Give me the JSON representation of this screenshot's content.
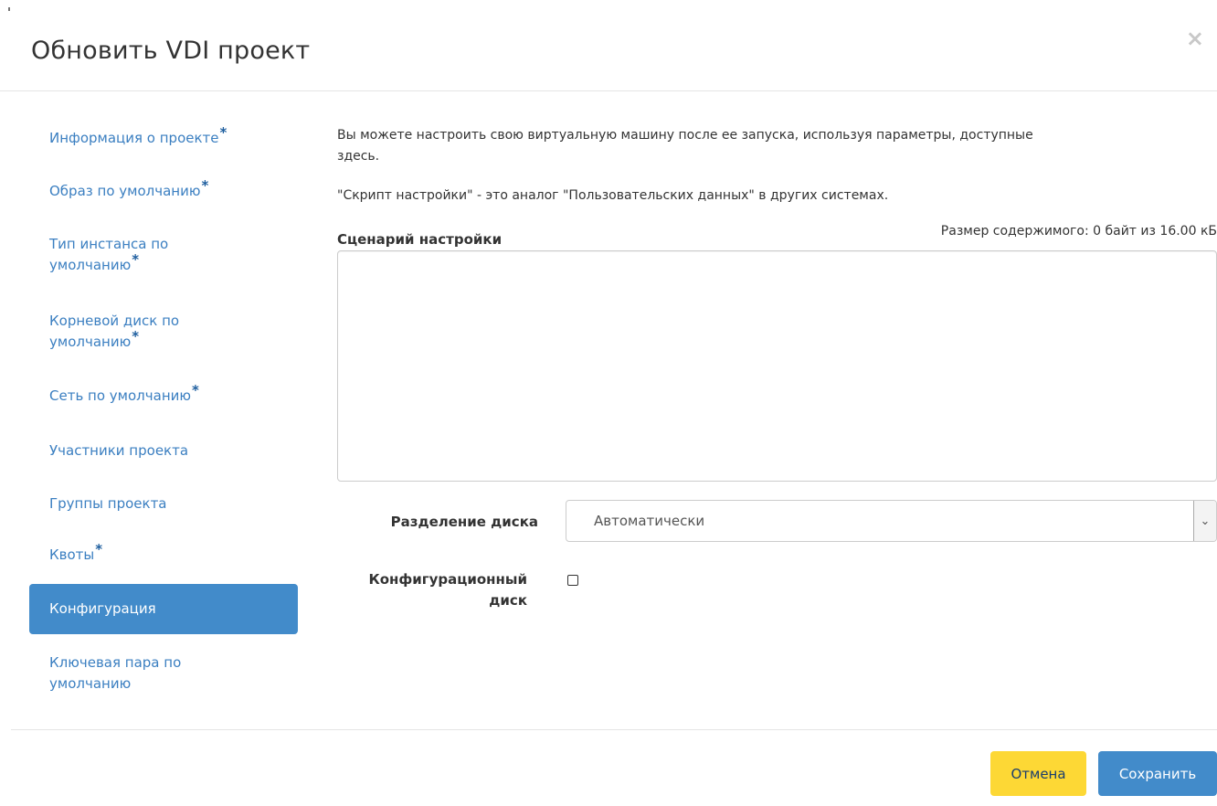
{
  "dialog": {
    "title": "Обновить VDI проект",
    "close_icon": "×"
  },
  "sidebar": {
    "items": [
      {
        "label": "Информация о проекте",
        "required": "*"
      },
      {
        "label": "Образ по умолчанию",
        "required": "*"
      },
      {
        "label_line1": "Тип инстанса по",
        "label_line2": "умолчанию",
        "required": "*"
      },
      {
        "label_line1": "Корневой диск по",
        "label_line2": "умолчанию",
        "required": "*"
      },
      {
        "label": "Сеть по умолчанию",
        "required": "*"
      },
      {
        "label": "Участники проекта"
      },
      {
        "label": "Группы проекта"
      },
      {
        "label": "Квоты",
        "required": "*"
      },
      {
        "label": "Конфигурация",
        "active": true
      },
      {
        "label_line1": "Ключевая пара по",
        "label_line2": "умолчанию"
      }
    ]
  },
  "main": {
    "help_line1": "Вы можете настроить свою виртуальную машину после ее запуска, используя параметры, доступные",
    "help_line1_wrap": "здесь.",
    "help_line2": "\"Скрипт настройки\" - это аналог \"Пользовательских данных\" в других системах.",
    "size_info": "Размер содержимого: 0 байт из 16.00 кБ",
    "script_label": "Сценарий настройки",
    "script_value": "",
    "disk_partition_label": "Разделение диска",
    "disk_partition_value": "Автоматически",
    "config_drive_label_line1": "Конфигурационный",
    "config_drive_label_line2": "диск",
    "config_drive_checked": false
  },
  "footer": {
    "cancel_label": "Отмена",
    "save_label": "Сохранить"
  },
  "colors": {
    "accent": "#428bca",
    "cancel": "#fdd835",
    "link": "#3b7fc1"
  }
}
